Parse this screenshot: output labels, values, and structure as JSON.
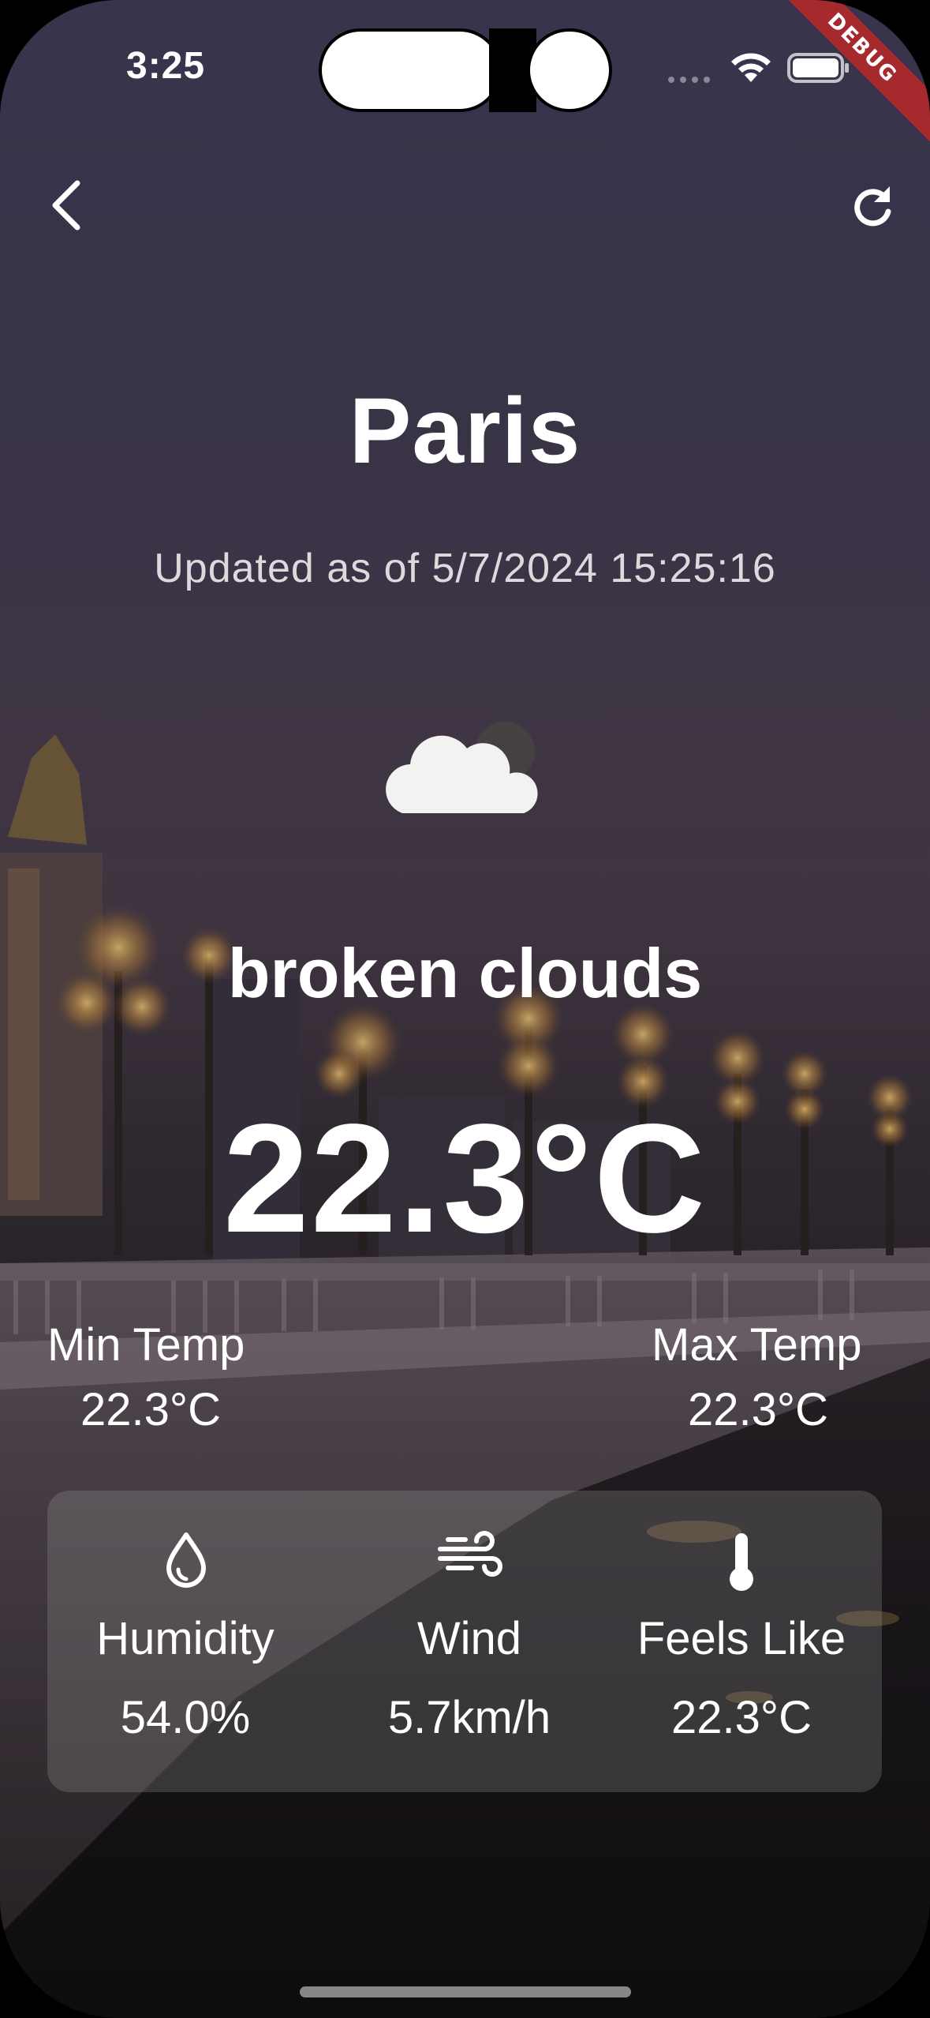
{
  "status_bar": {
    "time": "3:25",
    "debug_label": "DEBUG"
  },
  "app_bar": {
    "back_icon": "chevron-left-icon",
    "refresh_icon": "refresh-icon"
  },
  "weather": {
    "city": "Paris",
    "updated": "Updated as of 5/7/2024 15:25:16",
    "condition_icon": "cloud-icon",
    "condition": "broken clouds",
    "temperature": "22.3°C",
    "min_label": "Min Temp",
    "min_value": "22.3°C",
    "max_label": "Max Temp",
    "max_value": "22.3°C"
  },
  "details": [
    {
      "icon": "water-drop-icon",
      "label": "Humidity",
      "value": "54.0%"
    },
    {
      "icon": "wind-icon",
      "label": "Wind",
      "value": "5.7km/h"
    },
    {
      "icon": "thermometer-icon",
      "label": "Feels Like",
      "value": "22.3°C"
    }
  ],
  "colors": {
    "debug_banner": "#a5292d",
    "card": "rgba(150,150,150,0.28)"
  }
}
